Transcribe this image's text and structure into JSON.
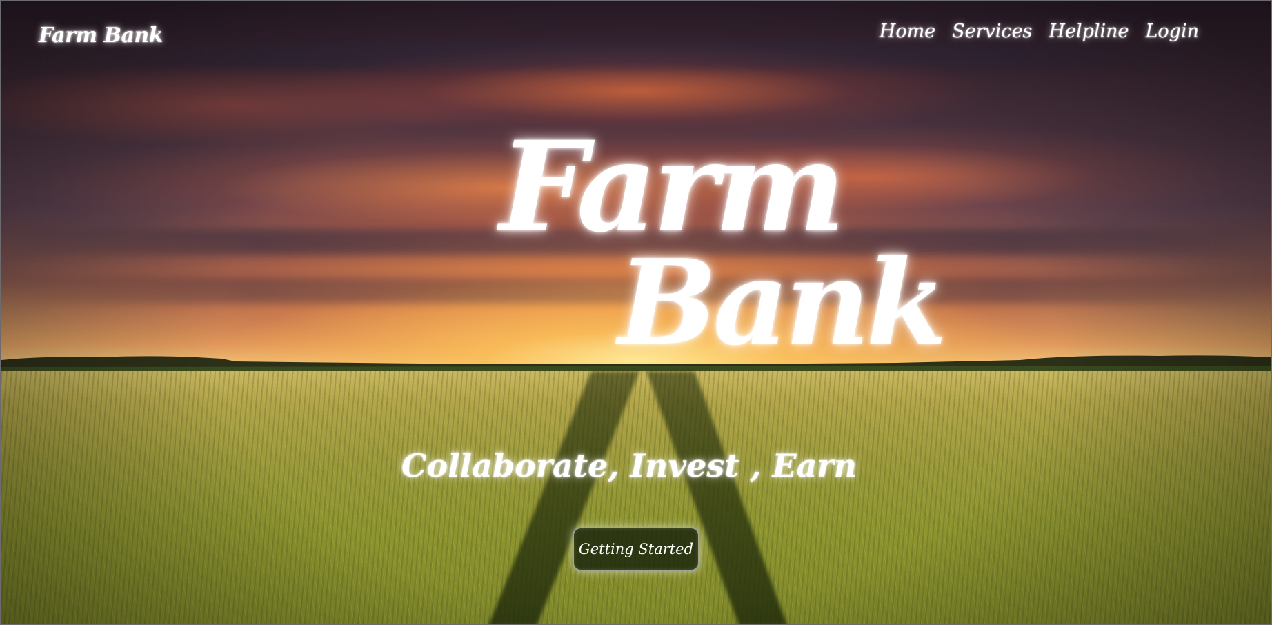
{
  "navbar": {
    "brand": "Farm Bank",
    "links": [
      "Home",
      "Services",
      "Helpline",
      "Login"
    ]
  },
  "hero": {
    "title_line1": "Farm",
    "title_line2": "Bank",
    "tagline": "Collaborate, Invest , Earn",
    "cta_label": "Getting Started"
  },
  "colors": {
    "text": "#ffffff",
    "cta_background": "#19230c"
  },
  "background_image": "sunset-over-wheat-field"
}
